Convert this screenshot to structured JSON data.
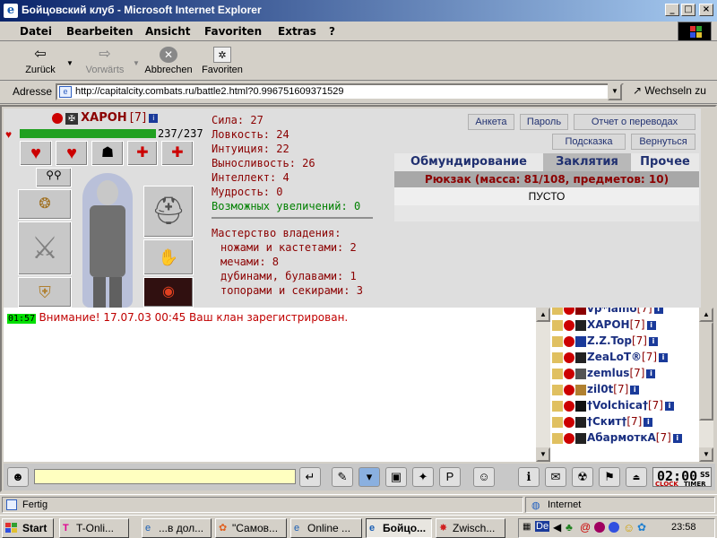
{
  "window": {
    "title": "Бойцовский клуб - Microsoft Internet Explorer",
    "title_bar_color": "#0a246a"
  },
  "menu": {
    "items": [
      "Datei",
      "Bearbeiten",
      "Ansicht",
      "Favoriten",
      "Extras",
      "?"
    ]
  },
  "toolbar": {
    "back": "Zurück",
    "forward": "Vorwärts",
    "stop": "Abbrechen",
    "favorites": "Favoriten"
  },
  "address": {
    "label": "Adresse",
    "url": "http://capitalcity.combats.ru/battle2.html?0.996751609371529",
    "go": "Wechseln zu"
  },
  "character": {
    "name": "ХАРОН",
    "level": "[7]",
    "hp": "237/237",
    "hp_fraction": 1.0,
    "stats": [
      "Сила: 27",
      "Ловкость: 24",
      "Интуиция: 22",
      "Выносливость: 26",
      "Интеллект: 4",
      "Мудрость: 0"
    ],
    "upgrades": "Возможных увеличений: 0",
    "mastery_title": "Мастерство владения:",
    "mastery": [
      "ножами и кастетами: 2",
      "мечами: 8",
      "дубинами, булавами: 1",
      "топорами и секирами: 3"
    ]
  },
  "buttons": {
    "anketa": "Анкета",
    "password": "Пароль",
    "transfers": "Отчет о переводах",
    "hint": "Подсказка",
    "return": "Вернуться"
  },
  "tabs": {
    "items": [
      "Обмундирование",
      "Заклятия",
      "Прочее"
    ],
    "active": "Заклятия"
  },
  "backpack": {
    "header": "Рюкзак (масса: 81/108, предметов: 10)",
    "content": "ПУСТО"
  },
  "chat": {
    "time": "01:57",
    "message": "Внимание! 17.07.03 00:45 Ваш клан зарегистрирован."
  },
  "online_users": [
    {
      "name": "vp*lamo",
      "level": "[7]"
    },
    {
      "name": "ХАРОН",
      "level": "[7]"
    },
    {
      "name": "Z.Z.Top",
      "level": "[7]"
    },
    {
      "name": "ZeaLoT®",
      "level": "[7]"
    },
    {
      "name": "zemlus",
      "level": "[7]"
    },
    {
      "name": "zil0t",
      "level": "[7]"
    },
    {
      "name": "†Volchica†",
      "level": "[7]"
    },
    {
      "name": "†Скит†",
      "level": "[7]"
    },
    {
      "name": "АбармоткА",
      "level": "[7]"
    }
  ],
  "clock": {
    "time": "02:00",
    "seconds": "SS",
    "clock_label": "CLOCK",
    "timer_label": "TIMER"
  },
  "status": {
    "text": "Fertig",
    "zone": "Internet"
  },
  "taskbar": {
    "start": "Start",
    "tasks": [
      "T-Onli...",
      "...в дол...",
      "\"Самов...",
      "Online ...",
      "Бойцо...",
      "Zwisch..."
    ],
    "active_index": 4,
    "tray_time": "23:58",
    "tray_lang": "De"
  }
}
